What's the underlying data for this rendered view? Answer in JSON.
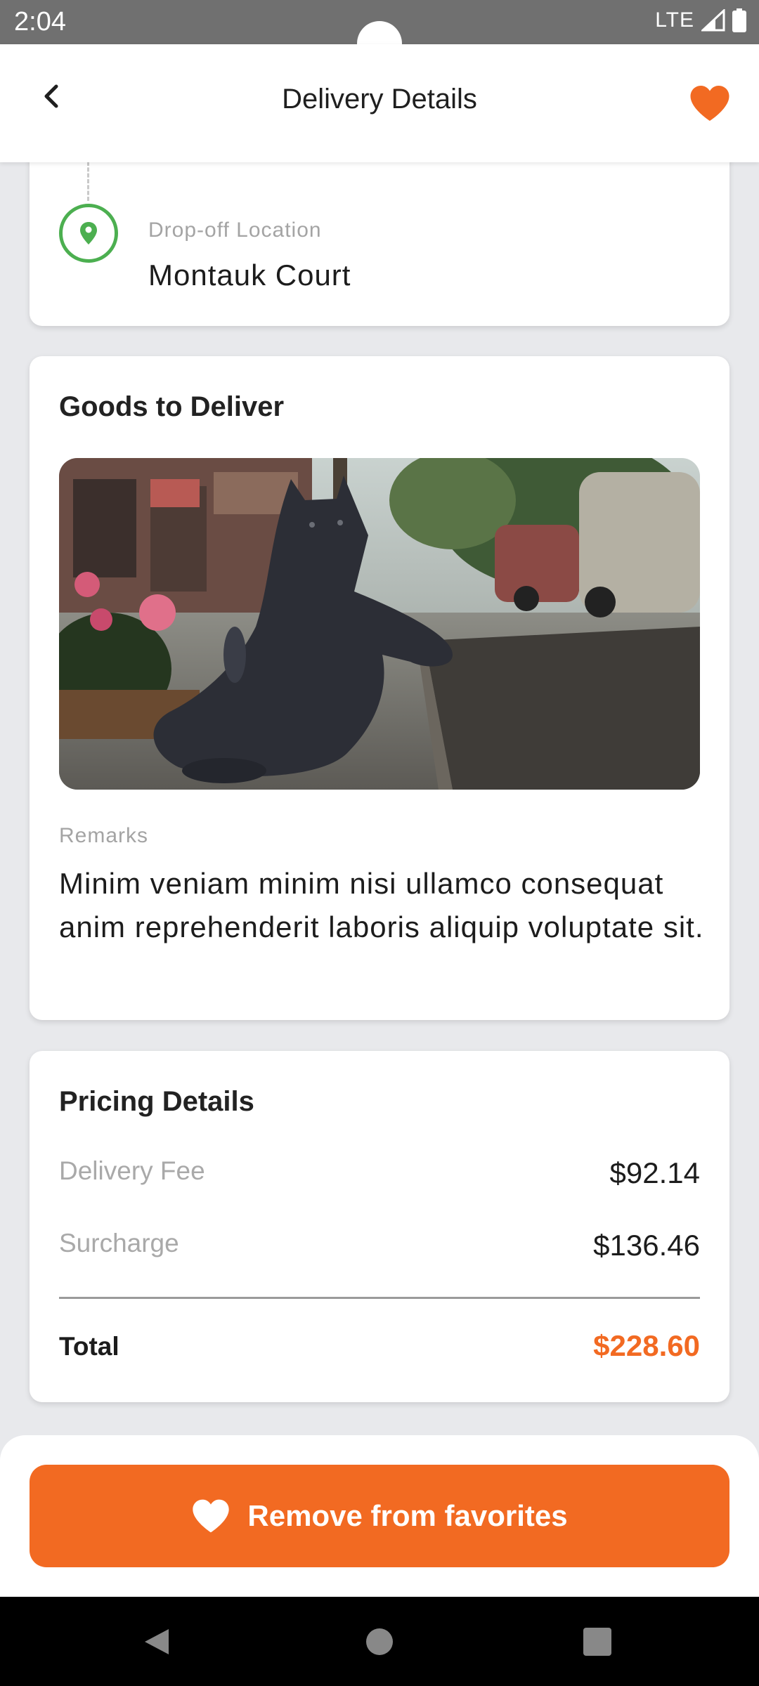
{
  "status_bar": {
    "time": "2:04",
    "network": "LTE"
  },
  "app_bar": {
    "title": "Delivery Details"
  },
  "dropoff": {
    "label": "Drop-off Location",
    "value": "Montauk Court"
  },
  "goods": {
    "title": "Goods to Deliver",
    "remarks_label": "Remarks",
    "remarks": "Minim veniam minim nisi ullamco consequat anim reprehenderit laboris aliquip voluptate sit."
  },
  "pricing": {
    "title": "Pricing Details",
    "rows": [
      {
        "label": "Delivery Fee",
        "value": "$92.14"
      },
      {
        "label": "Surcharge",
        "value": "$136.46"
      }
    ],
    "total_label": "Total",
    "total_value": "$228.60"
  },
  "actions": {
    "remove_favorite_label": "Remove from favorites"
  },
  "colors": {
    "accent": "#f26a22",
    "pin": "#4caf50"
  }
}
